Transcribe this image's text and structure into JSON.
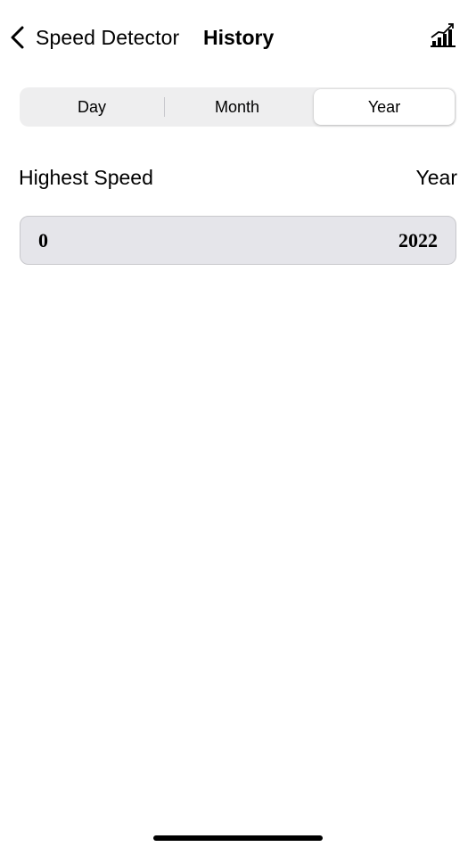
{
  "nav": {
    "back_label": "Speed Detector",
    "title": "History",
    "back_icon": "chevron-left-icon",
    "chart_icon": "bar-chart-icon"
  },
  "segments": {
    "items": [
      {
        "label": "Day",
        "selected": false
      },
      {
        "label": "Month",
        "selected": false
      },
      {
        "label": "Year",
        "selected": true
      }
    ]
  },
  "table": {
    "header_left": "Highest Speed",
    "header_right": "Year",
    "rows": [
      {
        "speed": "0",
        "year": "2022"
      }
    ]
  },
  "colors": {
    "background": "#ffffff",
    "segment_track": "#eeeeef",
    "row_fill": "#e5e5ea",
    "row_border": "#c8c8cc"
  }
}
